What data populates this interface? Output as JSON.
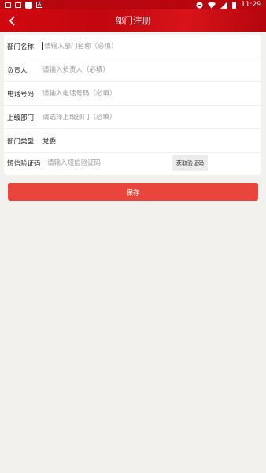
{
  "status_bar": {
    "time": "11:29",
    "left_icons": [
      "gallery-icon",
      "image-icon",
      "app-icon",
      "a-icon"
    ],
    "right_icons": [
      "do-not-disturb-icon",
      "wifi-icon",
      "signal-icon",
      "battery-icon"
    ]
  },
  "header": {
    "title": "部门注册",
    "back_icon": "chevron-left-icon"
  },
  "form": {
    "department_name": {
      "label": "部门名称",
      "placeholder": "请输入部门名称（必填）",
      "value": ""
    },
    "leader": {
      "label": "负责人",
      "placeholder": "请输入负责人（必填）",
      "value": ""
    },
    "phone": {
      "label": "电话号码",
      "placeholder": "请输入电话号码（必填）",
      "value": ""
    },
    "parent_department": {
      "label": "上级部门",
      "placeholder": "请选择上级部门（必填）",
      "value": ""
    },
    "department_type": {
      "label": "部门类型",
      "value": "党委"
    },
    "sms_code": {
      "label": "短信验证码",
      "placeholder": "请输入短信验证码",
      "value": "",
      "button_label": "获取验证码"
    }
  },
  "actions": {
    "save_label": "保存"
  },
  "colors": {
    "header_red": "#c2070f",
    "save_button": "#e8453c",
    "background": "#f2f1ee"
  }
}
